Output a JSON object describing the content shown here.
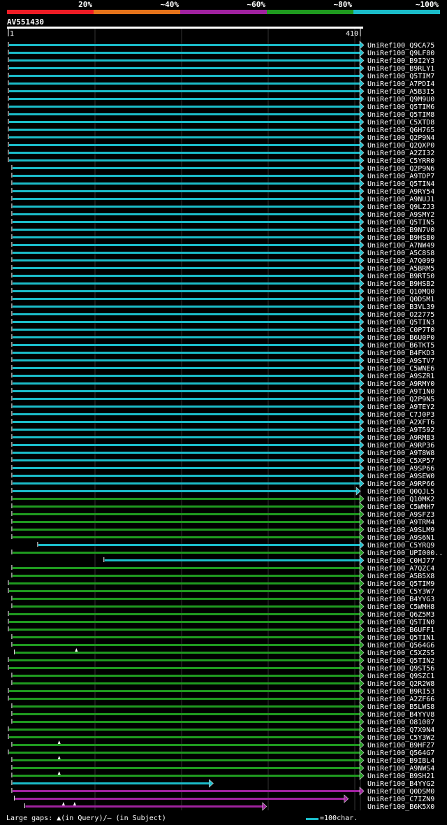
{
  "legend": [
    {
      "label": "20%",
      "color": "#ee1c25"
    },
    {
      "label": "~40%",
      "color": "#e5731a"
    },
    {
      "label": "~60%",
      "color": "#a0229f"
    },
    {
      "label": "~80%",
      "color": "#1f9a1f"
    },
    {
      "label": "~100%",
      "color": "#1bbcc9"
    }
  ],
  "query": {
    "name": "AV551430",
    "start_label": "1",
    "end_label": "410"
  },
  "footer": {
    "gaps_label": "Large gaps: ▲(in Query)/‒ (in Subject)",
    "scale_label": "=100char."
  },
  "chart_data": {
    "type": "alignment",
    "query_length": 410,
    "grid": true,
    "colors": {
      "cyan": "#1bbcc9",
      "green": "#1f9a1f",
      "purple": "#a0229f"
    },
    "hits": [
      {
        "name": "UniRef100_Q9CA75",
        "start": 1,
        "end": 410,
        "color": "cyan",
        "arrow": true
      },
      {
        "name": "UniRef100_Q9LF80",
        "start": 1,
        "end": 410,
        "color": "cyan",
        "arrow": true
      },
      {
        "name": "UniRef100_B9I2Y3",
        "start": 1,
        "end": 410,
        "color": "cyan",
        "arrow": true
      },
      {
        "name": "UniRef100_B9RLY1",
        "start": 1,
        "end": 410,
        "color": "cyan",
        "arrow": true
      },
      {
        "name": "UniRef100_Q5TIM7",
        "start": 1,
        "end": 410,
        "color": "cyan",
        "arrow": true
      },
      {
        "name": "UniRef100_A7PDI4",
        "start": 1,
        "end": 410,
        "color": "cyan",
        "arrow": true
      },
      {
        "name": "UniRef100_A5B3I5",
        "start": 1,
        "end": 410,
        "color": "cyan",
        "arrow": true
      },
      {
        "name": "UniRef100_Q9M9U0",
        "start": 1,
        "end": 410,
        "color": "cyan",
        "arrow": true
      },
      {
        "name": "UniRef100_Q5TIM6",
        "start": 1,
        "end": 410,
        "color": "cyan",
        "arrow": true
      },
      {
        "name": "UniRef100_Q5TIM8",
        "start": 1,
        "end": 410,
        "color": "cyan",
        "arrow": true
      },
      {
        "name": "UniRef100_C5XTD8",
        "start": 1,
        "end": 410,
        "color": "cyan",
        "arrow": true
      },
      {
        "name": "UniRef100_Q6H765",
        "start": 1,
        "end": 410,
        "color": "cyan",
        "arrow": true
      },
      {
        "name": "UniRef100_Q2P9N4",
        "start": 1,
        "end": 410,
        "color": "cyan",
        "arrow": true
      },
      {
        "name": "UniRef100_Q2QXP0",
        "start": 1,
        "end": 410,
        "color": "cyan",
        "arrow": true
      },
      {
        "name": "UniRef100_A2ZI32",
        "start": 1,
        "end": 410,
        "color": "cyan",
        "arrow": true
      },
      {
        "name": "UniRef100_C5YRR0",
        "start": 1,
        "end": 410,
        "color": "cyan",
        "arrow": true
      },
      {
        "name": "UniRef100_Q2P9N6",
        "start": 5,
        "end": 410,
        "color": "cyan",
        "arrow": true
      },
      {
        "name": "UniRef100_A9TDP7",
        "start": 5,
        "end": 410,
        "color": "cyan",
        "arrow": true
      },
      {
        "name": "UniRef100_Q5TIN4",
        "start": 5,
        "end": 410,
        "color": "cyan",
        "arrow": true
      },
      {
        "name": "UniRef100_A9RY54",
        "start": 5,
        "end": 410,
        "color": "cyan",
        "arrow": true
      },
      {
        "name": "UniRef100_A9NUJ1",
        "start": 5,
        "end": 410,
        "color": "cyan",
        "arrow": true
      },
      {
        "name": "UniRef100_Q9LZJ3",
        "start": 5,
        "end": 410,
        "color": "cyan",
        "arrow": true
      },
      {
        "name": "UniRef100_A9SMY2",
        "start": 5,
        "end": 410,
        "color": "cyan",
        "arrow": true
      },
      {
        "name": "UniRef100_Q5TIN5",
        "start": 5,
        "end": 410,
        "color": "cyan",
        "arrow": true
      },
      {
        "name": "UniRef100_B9N7V0",
        "start": 5,
        "end": 410,
        "color": "cyan",
        "arrow": true
      },
      {
        "name": "UniRef100_B9HSB0",
        "start": 5,
        "end": 410,
        "color": "cyan",
        "arrow": true
      },
      {
        "name": "UniRef100_A7NW49",
        "start": 5,
        "end": 410,
        "color": "cyan",
        "arrow": true
      },
      {
        "name": "UniRef100_A5C8S8",
        "start": 5,
        "end": 410,
        "color": "cyan",
        "arrow": true
      },
      {
        "name": "UniRef100_A7Q099",
        "start": 5,
        "end": 410,
        "color": "cyan",
        "arrow": true
      },
      {
        "name": "UniRef100_A5BRM5",
        "start": 5,
        "end": 410,
        "color": "cyan",
        "arrow": true
      },
      {
        "name": "UniRef100_B9RT50",
        "start": 5,
        "end": 410,
        "color": "cyan",
        "arrow": true
      },
      {
        "name": "UniRef100_B9HSB2",
        "start": 5,
        "end": 410,
        "color": "cyan",
        "arrow": true
      },
      {
        "name": "UniRef100_Q10MQ0",
        "start": 5,
        "end": 410,
        "color": "cyan",
        "arrow": true
      },
      {
        "name": "UniRef100_Q0DSM1",
        "start": 5,
        "end": 410,
        "color": "cyan",
        "arrow": true
      },
      {
        "name": "UniRef100_B3VL39",
        "start": 5,
        "end": 410,
        "color": "cyan",
        "arrow": true
      },
      {
        "name": "UniRef100_O22775",
        "start": 5,
        "end": 410,
        "color": "cyan",
        "arrow": true
      },
      {
        "name": "UniRef100_Q5TIN3",
        "start": 5,
        "end": 410,
        "color": "cyan",
        "arrow": true
      },
      {
        "name": "UniRef100_C0P7T0",
        "start": 5,
        "end": 410,
        "color": "cyan",
        "arrow": true
      },
      {
        "name": "UniRef100_B6U0P0",
        "start": 5,
        "end": 410,
        "color": "cyan",
        "arrow": true
      },
      {
        "name": "UniRef100_B6TKT5",
        "start": 5,
        "end": 410,
        "color": "cyan",
        "arrow": true
      },
      {
        "name": "UniRef100_B4FKD3",
        "start": 5,
        "end": 410,
        "color": "cyan",
        "arrow": true
      },
      {
        "name": "UniRef100_A9STV7",
        "start": 5,
        "end": 410,
        "color": "cyan",
        "arrow": true
      },
      {
        "name": "UniRef100_C5WNE6",
        "start": 5,
        "end": 410,
        "color": "cyan",
        "arrow": true
      },
      {
        "name": "UniRef100_A9SZR1",
        "start": 5,
        "end": 410,
        "color": "cyan",
        "arrow": true
      },
      {
        "name": "UniRef100_A9RMY0",
        "start": 5,
        "end": 410,
        "color": "cyan",
        "arrow": true
      },
      {
        "name": "UniRef100_A9T1N0",
        "start": 5,
        "end": 410,
        "color": "cyan",
        "arrow": true
      },
      {
        "name": "UniRef100_Q2P9N5",
        "start": 5,
        "end": 410,
        "color": "cyan",
        "arrow": true
      },
      {
        "name": "UniRef100_A9TEY2",
        "start": 5,
        "end": 410,
        "color": "cyan",
        "arrow": true
      },
      {
        "name": "UniRef100_C7J0P3",
        "start": 5,
        "end": 410,
        "color": "cyan",
        "arrow": true
      },
      {
        "name": "UniRef100_A2XFT6",
        "start": 5,
        "end": 410,
        "color": "cyan",
        "arrow": true
      },
      {
        "name": "UniRef100_A9T592",
        "start": 5,
        "end": 410,
        "color": "cyan",
        "arrow": true
      },
      {
        "name": "UniRef100_A9RMB3",
        "start": 5,
        "end": 410,
        "color": "cyan",
        "arrow": true
      },
      {
        "name": "UniRef100_A9RP36",
        "start": 5,
        "end": 410,
        "color": "cyan",
        "arrow": true
      },
      {
        "name": "UniRef100_A9T8W8",
        "start": 5,
        "end": 410,
        "color": "cyan",
        "arrow": true
      },
      {
        "name": "UniRef100_C5XP57",
        "start": 5,
        "end": 410,
        "color": "cyan",
        "arrow": true
      },
      {
        "name": "UniRef100_A9SP66",
        "start": 5,
        "end": 410,
        "color": "cyan",
        "arrow": true
      },
      {
        "name": "UniRef100_A9SEW0",
        "start": 5,
        "end": 410,
        "color": "cyan",
        "arrow": true
      },
      {
        "name": "UniRef100_A9RP66",
        "start": 5,
        "end": 410,
        "color": "cyan",
        "arrow": true
      },
      {
        "name": "UniRef100_Q0QJL5",
        "start": 5,
        "end": 406,
        "color": "cyan",
        "arrow": true
      },
      {
        "name": "UniRef100_Q10MK2",
        "start": 5,
        "end": 410,
        "color": "green",
        "arrow": true
      },
      {
        "name": "UniRef100_C5WMH7",
        "start": 5,
        "end": 410,
        "color": "green",
        "arrow": true
      },
      {
        "name": "UniRef100_A9SFZ3",
        "start": 5,
        "end": 410,
        "color": "green",
        "arrow": true
      },
      {
        "name": "UniRef100_A9TRM4",
        "start": 5,
        "end": 410,
        "color": "green",
        "arrow": true
      },
      {
        "name": "UniRef100_A9SLM9",
        "start": 5,
        "end": 410,
        "color": "green",
        "arrow": true
      },
      {
        "name": "UniRef100_A9S6N1",
        "start": 5,
        "end": 410,
        "color": "green",
        "arrow": true
      },
      {
        "name": "UniRef100_C5YRQ9",
        "start": 35,
        "end": 410,
        "color": "cyan",
        "arrow": true
      },
      {
        "name": "UniRef100_UPI000..",
        "start": 5,
        "end": 410,
        "color": "green",
        "arrow": true
      },
      {
        "name": "UniRef100_C0HJ77",
        "start": 112,
        "end": 410,
        "color": "cyan",
        "arrow": true
      },
      {
        "name": "UniRef100_A7QZC4",
        "start": 5,
        "end": 410,
        "color": "green",
        "arrow": true
      },
      {
        "name": "UniRef100_A5B5X8",
        "start": 5,
        "end": 410,
        "color": "green",
        "arrow": true
      },
      {
        "name": "UniRef100_Q5TIM9",
        "start": 1,
        "end": 410,
        "color": "green",
        "arrow": true
      },
      {
        "name": "UniRef100_C5Y3W7",
        "start": 1,
        "end": 410,
        "color": "green",
        "arrow": true
      },
      {
        "name": "UniRef100_B4YYG3",
        "start": 5,
        "end": 410,
        "color": "green",
        "arrow": true
      },
      {
        "name": "UniRef100_C5WMH8",
        "start": 5,
        "end": 410,
        "color": "green",
        "arrow": true
      },
      {
        "name": "UniRef100_Q6Z5M3",
        "start": 1,
        "end": 410,
        "color": "green",
        "arrow": true
      },
      {
        "name": "UniRef100_Q5TIN0",
        "start": 1,
        "end": 410,
        "color": "green",
        "arrow": true
      },
      {
        "name": "UniRef100_B6UFF1",
        "start": 1,
        "end": 410,
        "color": "green",
        "arrow": true
      },
      {
        "name": "UniRef100_Q5TIN1",
        "start": 5,
        "end": 410,
        "color": "green",
        "arrow": true
      },
      {
        "name": "UniRef100_Q564G6",
        "start": 5,
        "end": 410,
        "color": "green",
        "arrow": true
      },
      {
        "name": "UniRef100_C5XZS5",
        "start": 8,
        "end": 410,
        "color": "green",
        "arrow": true,
        "query_gaps": [
          80
        ]
      },
      {
        "name": "UniRef100_Q5TIN2",
        "start": 1,
        "end": 410,
        "color": "green",
        "arrow": true
      },
      {
        "name": "UniRef100_Q9ST56",
        "start": 1,
        "end": 410,
        "color": "green",
        "arrow": true
      },
      {
        "name": "UniRef100_Q9SZC1",
        "start": 5,
        "end": 410,
        "color": "green",
        "arrow": true
      },
      {
        "name": "UniRef100_Q2R2W8",
        "start": 5,
        "end": 410,
        "color": "green",
        "arrow": true
      },
      {
        "name": "UniRef100_B9RI53",
        "start": 1,
        "end": 410,
        "color": "green",
        "arrow": true
      },
      {
        "name": "UniRef100_A2ZF66",
        "start": 1,
        "end": 410,
        "color": "green",
        "arrow": true
      },
      {
        "name": "UniRef100_B5LWS8",
        "start": 5,
        "end": 410,
        "color": "green",
        "arrow": true
      },
      {
        "name": "UniRef100_B4YYV8",
        "start": 5,
        "end": 410,
        "color": "green",
        "arrow": true
      },
      {
        "name": "UniRef100_O81007",
        "start": 5,
        "end": 410,
        "color": "green",
        "arrow": true
      },
      {
        "name": "UniRef100_Q7X9N4",
        "start": 1,
        "end": 410,
        "color": "green",
        "arrow": true
      },
      {
        "name": "UniRef100_C5Y3W2",
        "start": 1,
        "end": 410,
        "color": "green",
        "arrow": true
      },
      {
        "name": "UniRef100_B9HFZ7",
        "start": 5,
        "end": 410,
        "color": "green",
        "arrow": true,
        "query_gaps": [
          60
        ]
      },
      {
        "name": "UniRef100_Q564G7",
        "start": 1,
        "end": 410,
        "color": "green",
        "arrow": true
      },
      {
        "name": "UniRef100_B9IBL4",
        "start": 5,
        "end": 410,
        "color": "green",
        "arrow": true,
        "query_gaps": [
          60
        ]
      },
      {
        "name": "UniRef100_A9NWS4",
        "start": 5,
        "end": 410,
        "color": "green",
        "arrow": true
      },
      {
        "name": "UniRef100_B9SH21",
        "start": 5,
        "end": 410,
        "color": "green",
        "arrow": true,
        "query_gaps": [
          60
        ]
      },
      {
        "name": "UniRef100_B4YYG2",
        "start": 5,
        "end": 235,
        "color": "cyan",
        "arrow": true
      },
      {
        "name": "UniRef100_Q0DSM0",
        "start": 5,
        "end": 410,
        "color": "purple",
        "arrow": true
      },
      {
        "name": "UniRef100_C7IZN9",
        "start": 8,
        "end": 392,
        "color": "purple",
        "arrow": true
      },
      {
        "name": "UniRef100_B6K5X0",
        "start": 20,
        "end": 297,
        "color": "purple",
        "arrow": true,
        "query_gaps": [
          65,
          78
        ]
      }
    ]
  }
}
